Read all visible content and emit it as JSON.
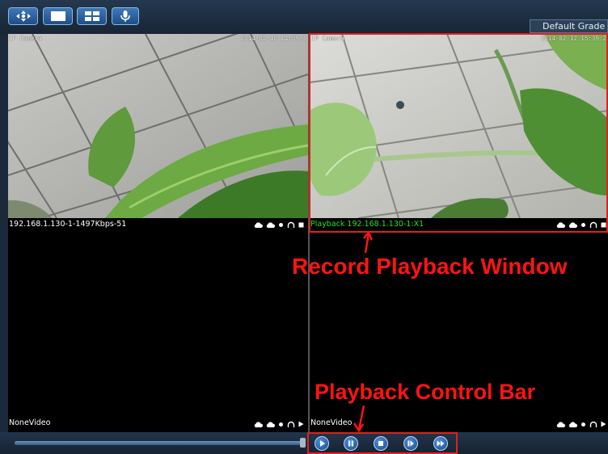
{
  "toolbar": {
    "buttons": [
      {
        "icon": "ptz-control-icon"
      },
      {
        "icon": "single-view-icon"
      },
      {
        "icon": "quad-view-icon"
      },
      {
        "icon": "microphone-icon"
      }
    ],
    "grade_label": "Default Grade"
  },
  "panes": [
    {
      "osd_name": "IP Camera",
      "osd_time": "2014-02-18 14:39:3",
      "status_label": "192.168.1.130-1-1497Kbps-51",
      "status_color": "#ffffff"
    },
    {
      "osd_name": "IP Camera",
      "osd_time": "2014-02-12 15:39:2",
      "status_label": "Playback 192.168.1.130-1:X1",
      "status_color": "#25e025"
    },
    {
      "status_label": "NoneVideo",
      "status_color": "#ffffff"
    },
    {
      "status_label": "NoneVideo",
      "status_color": "#ffffff"
    }
  ],
  "playback": {
    "progress": 1.0,
    "buttons": [
      {
        "name": "play"
      },
      {
        "name": "pause"
      },
      {
        "name": "stop"
      },
      {
        "name": "frame-step"
      },
      {
        "name": "fast-forward"
      }
    ]
  },
  "annotations": {
    "record_window": "Record Playback Window",
    "control_bar": "Playback Control Bar",
    "color": "#ff1414"
  }
}
